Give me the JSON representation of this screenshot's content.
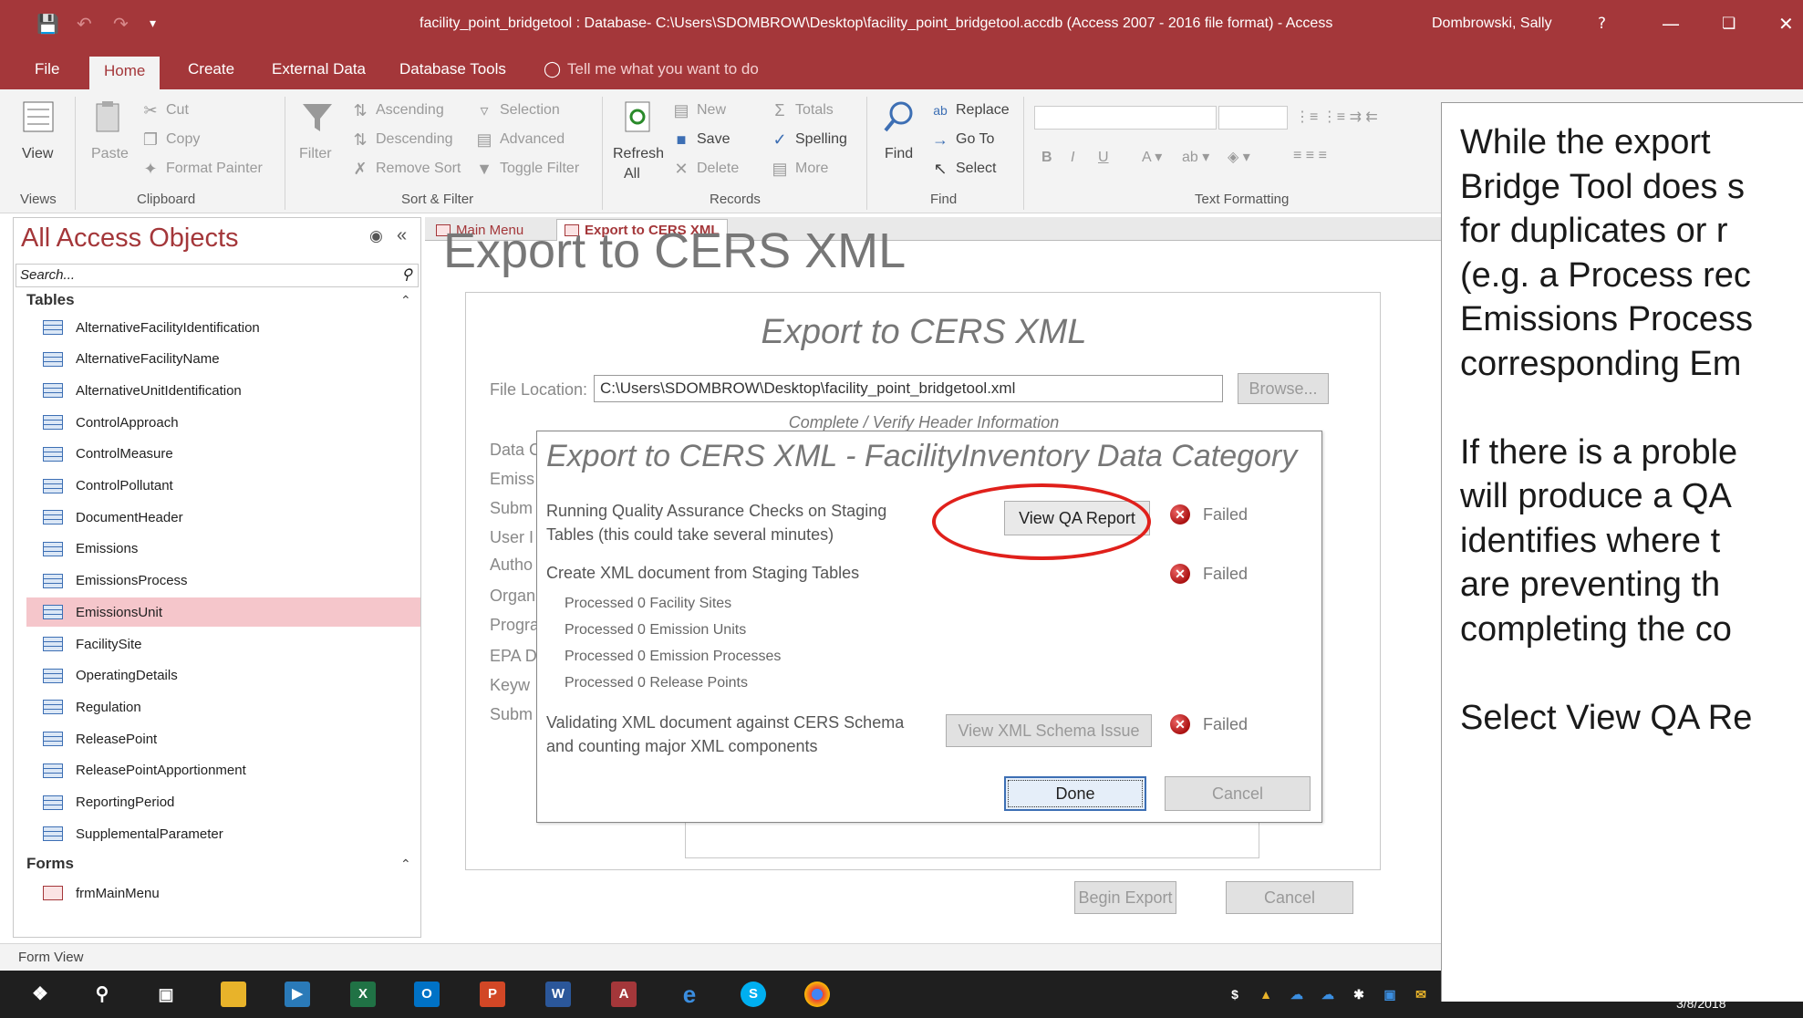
{
  "window": {
    "title": "facility_point_bridgetool : Database- C:\\Users\\SDOMBROW\\Desktop\\facility_point_bridgetool.accdb (Access 2007 - 2016 file format)  -  Access",
    "user": "Dombrowski, Sally",
    "help": "?"
  },
  "menu": {
    "tabs": [
      "File",
      "Home",
      "Create",
      "External Data",
      "Database Tools"
    ],
    "tell_me": "Tell me what you want to do"
  },
  "ribbon": {
    "views": {
      "view": "View",
      "label": "Views"
    },
    "clipboard": {
      "paste": "Paste",
      "cut": "Cut",
      "copy": "Copy",
      "format_painter": "Format Painter",
      "label": "Clipboard"
    },
    "sort_filter": {
      "filter": "Filter",
      "ascending": "Ascending",
      "descending": "Descending",
      "remove_sort": "Remove Sort",
      "selection": "Selection",
      "advanced": "Advanced",
      "toggle_filter": "Toggle Filter",
      "label": "Sort & Filter"
    },
    "records": {
      "refresh": "Refresh",
      "refresh_all": "All",
      "new": "New",
      "save": "Save",
      "delete": "Delete",
      "totals": "Totals",
      "spelling": "Spelling",
      "more": "More",
      "label": "Records"
    },
    "find": {
      "find": "Find",
      "replace": "Replace",
      "goto": "Go To",
      "select": "Select",
      "label": "Find"
    },
    "text_formatting": {
      "label": "Text Formatting",
      "bold": "B",
      "italic": "I",
      "underline": "U"
    }
  },
  "nav": {
    "title": "All Access Objects",
    "search_placeholder": "Search...",
    "tables_heading": "Tables",
    "tables": [
      "AlternativeFacilityIdentification",
      "AlternativeFacilityName",
      "AlternativeUnitIdentification",
      "ControlApproach",
      "ControlMeasure",
      "ControlPollutant",
      "DocumentHeader",
      "Emissions",
      "EmissionsProcess",
      "EmissionsUnit",
      "FacilitySite",
      "OperatingDetails",
      "Regulation",
      "ReleasePoint",
      "ReleasePointApportionment",
      "ReportingPeriod",
      "SupplementalParameter"
    ],
    "selected_table": "EmissionsUnit",
    "forms_heading": "Forms",
    "forms": [
      "frmMainMenu"
    ]
  },
  "doc_tabs": [
    "Main Menu",
    "Export to CERS XML"
  ],
  "form": {
    "bg_title": "Export to CERS XML",
    "title": "Export to CERS XML",
    "file_location_label": "File Location:",
    "file_location_value": "C:\\Users\\SDOMBROW\\Desktop\\facility_point_bridgetool.xml",
    "browse": "Browse...",
    "header_info": "Complete / Verify Header Information",
    "field_labels": [
      "Data C",
      "Emiss",
      "Subm",
      "User I",
      "Autho",
      "Organ",
      "Progra",
      "EPA D",
      "Keyw",
      "Subm"
    ],
    "begin_export": "Begin Export",
    "cancel": "Cancel"
  },
  "dialog": {
    "title": "Export to CERS XML - FacilityInventory Data Category",
    "step1": [
      "Running Quality Assurance Checks on Staging",
      "Tables (this could take several minutes)"
    ],
    "step1_button": "View QA Report",
    "step1_status": "Failed",
    "step2": "Create XML document from Staging Tables",
    "step2_status": "Failed",
    "processed": [
      "Processed 0 Facility Sites",
      "Processed 0 Emission Units",
      "Processed 0 Emission Processes",
      "Processed 0 Release Points"
    ],
    "step3": [
      "Validating XML document against CERS Schema",
      "and counting major XML components"
    ],
    "step3_button": "View XML Schema Issue",
    "step3_status": "Failed",
    "done": "Done",
    "cancel": "Cancel"
  },
  "statusbar": {
    "text": "Form View"
  },
  "taskbar": {
    "date": "3/8/2018"
  },
  "panel": {
    "lines": [
      "While the export",
      "Bridge Tool does s",
      "for duplicates or r",
      "(e.g. a Process rec",
      "Emissions Process",
      "corresponding Em",
      "",
      "If there is a proble",
      "will produce a QA",
      "identifies where t",
      "are preventing th",
      "completing the co",
      "",
      "Select View QA Re"
    ]
  },
  "colors": {
    "accent": "#a4373a",
    "highlight": "#e0201b",
    "selected": "#f5c6cb"
  }
}
